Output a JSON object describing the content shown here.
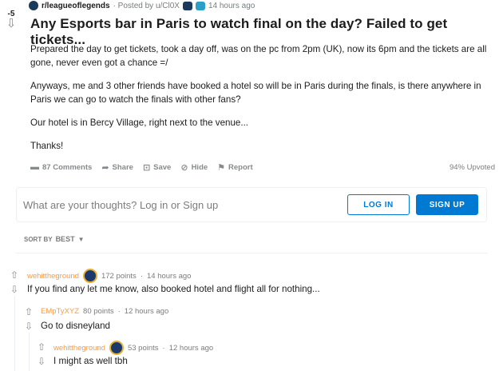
{
  "post": {
    "score": "-5",
    "subreddit": "r/leagueoflegends",
    "posted_by": "· Posted by u/Cl0X",
    "time": "14 hours ago",
    "title": "Any Esports bar in Paris to watch final on the day? Failed to get tickets...",
    "body": [
      "Prepared the day to get tickets, took a day off, was on the pc from 2pm (UK), now its 6pm and the tickets are all gone, never even got a chance =/",
      "Anyways, me and 3 other friends have booked a hotel so will be in Paris during the finals, is there anywhere in Paris we can go to watch the finals with other fans?",
      "Our hotel is in Bercy Village, right next to the venue...",
      "Thanks!"
    ],
    "actions": {
      "comments": "87 Comments",
      "share": "Share",
      "save": "Save",
      "hide": "Hide",
      "report": "Report"
    },
    "upvoted": "94% Upvoted"
  },
  "login": {
    "prompt": "What are your thoughts? Log in or Sign up",
    "login_label": "LOG IN",
    "signup_label": "SIGN UP"
  },
  "sort": {
    "label": "SORT BY",
    "value": "BEST"
  },
  "comments": [
    {
      "author": "wehittheground",
      "points": "172 points",
      "time": "14 hours ago",
      "text": "If you find any let me know, also booked hotel and flight all for nothing..."
    },
    {
      "author": "EMpTyXYZ",
      "points": "80 points",
      "time": "12 hours ago",
      "text": "Go to disneyland"
    },
    {
      "author": "wehittheground",
      "points": "53 points",
      "time": "12 hours ago",
      "text": "I might as well tbh"
    }
  ],
  "icons": {
    "upvote": "upvote-arrow-icon",
    "downvote": "downvote-arrow-icon",
    "comments": "comment-icon",
    "share": "share-arrow-icon",
    "save": "bookmark-icon",
    "hide": "hide-icon",
    "report": "flag-icon"
  },
  "colors": {
    "accent": "#0079d3",
    "author": "#ff9b3d"
  }
}
